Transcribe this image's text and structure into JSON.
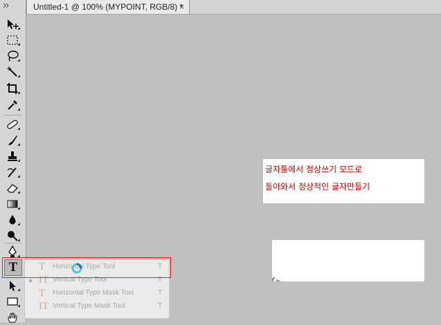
{
  "document_tab": {
    "title": "Untitled-1 @ 100% (MYPOINT, RGB/8) *",
    "close_symbol": "×"
  },
  "toolbar": {
    "tools": [
      "move-tool-icon",
      "marquee-tool-icon",
      "lasso-tool-icon",
      "magic-wand-tool-icon",
      "crop-tool-icon",
      "eyedropper-tool-icon",
      "healing-brush-icon",
      "brush-tool-icon",
      "clone-stamp-icon",
      "history-brush-icon",
      "eraser-tool-icon",
      "gradient-tool-icon",
      "blur-tool-icon",
      "dodge-tool-icon",
      "pen-tool-icon",
      "type-tool-icon",
      "path-selection-icon",
      "rectangle-tool-icon",
      "hand-tool-icon"
    ],
    "type_tool_glyph": "T"
  },
  "type_flyout": {
    "items": [
      {
        "label": "Horizontal Type Tool",
        "shortcut": "T",
        "icon": "horizontal-type-icon",
        "icon_glyph": "T"
      },
      {
        "label": "Vertical Type Tool",
        "shortcut": "T",
        "icon": "vertical-type-icon",
        "icon_glyph": "IT",
        "current": true
      },
      {
        "label": "Horizontal Type Mask Tool",
        "shortcut": "T",
        "icon": "horizontal-type-mask-icon",
        "icon_glyph": "T"
      },
      {
        "label": "Vertical Type Mask Tool",
        "shortcut": "T",
        "icon": "vertical-type-mask-icon",
        "icon_glyph": "IT"
      }
    ]
  },
  "canvas": {
    "note_lines": [
      "글자툴에서 정상쓰기 모드로",
      "돌아와서 정상적인 글자만들기"
    ],
    "curved_text": "MYPOINT"
  },
  "colors": {
    "note_text": "#c40000",
    "curved_text": "#2c6e12",
    "highlight": "#e52121",
    "canvas_bg": "#c0c0c0"
  }
}
